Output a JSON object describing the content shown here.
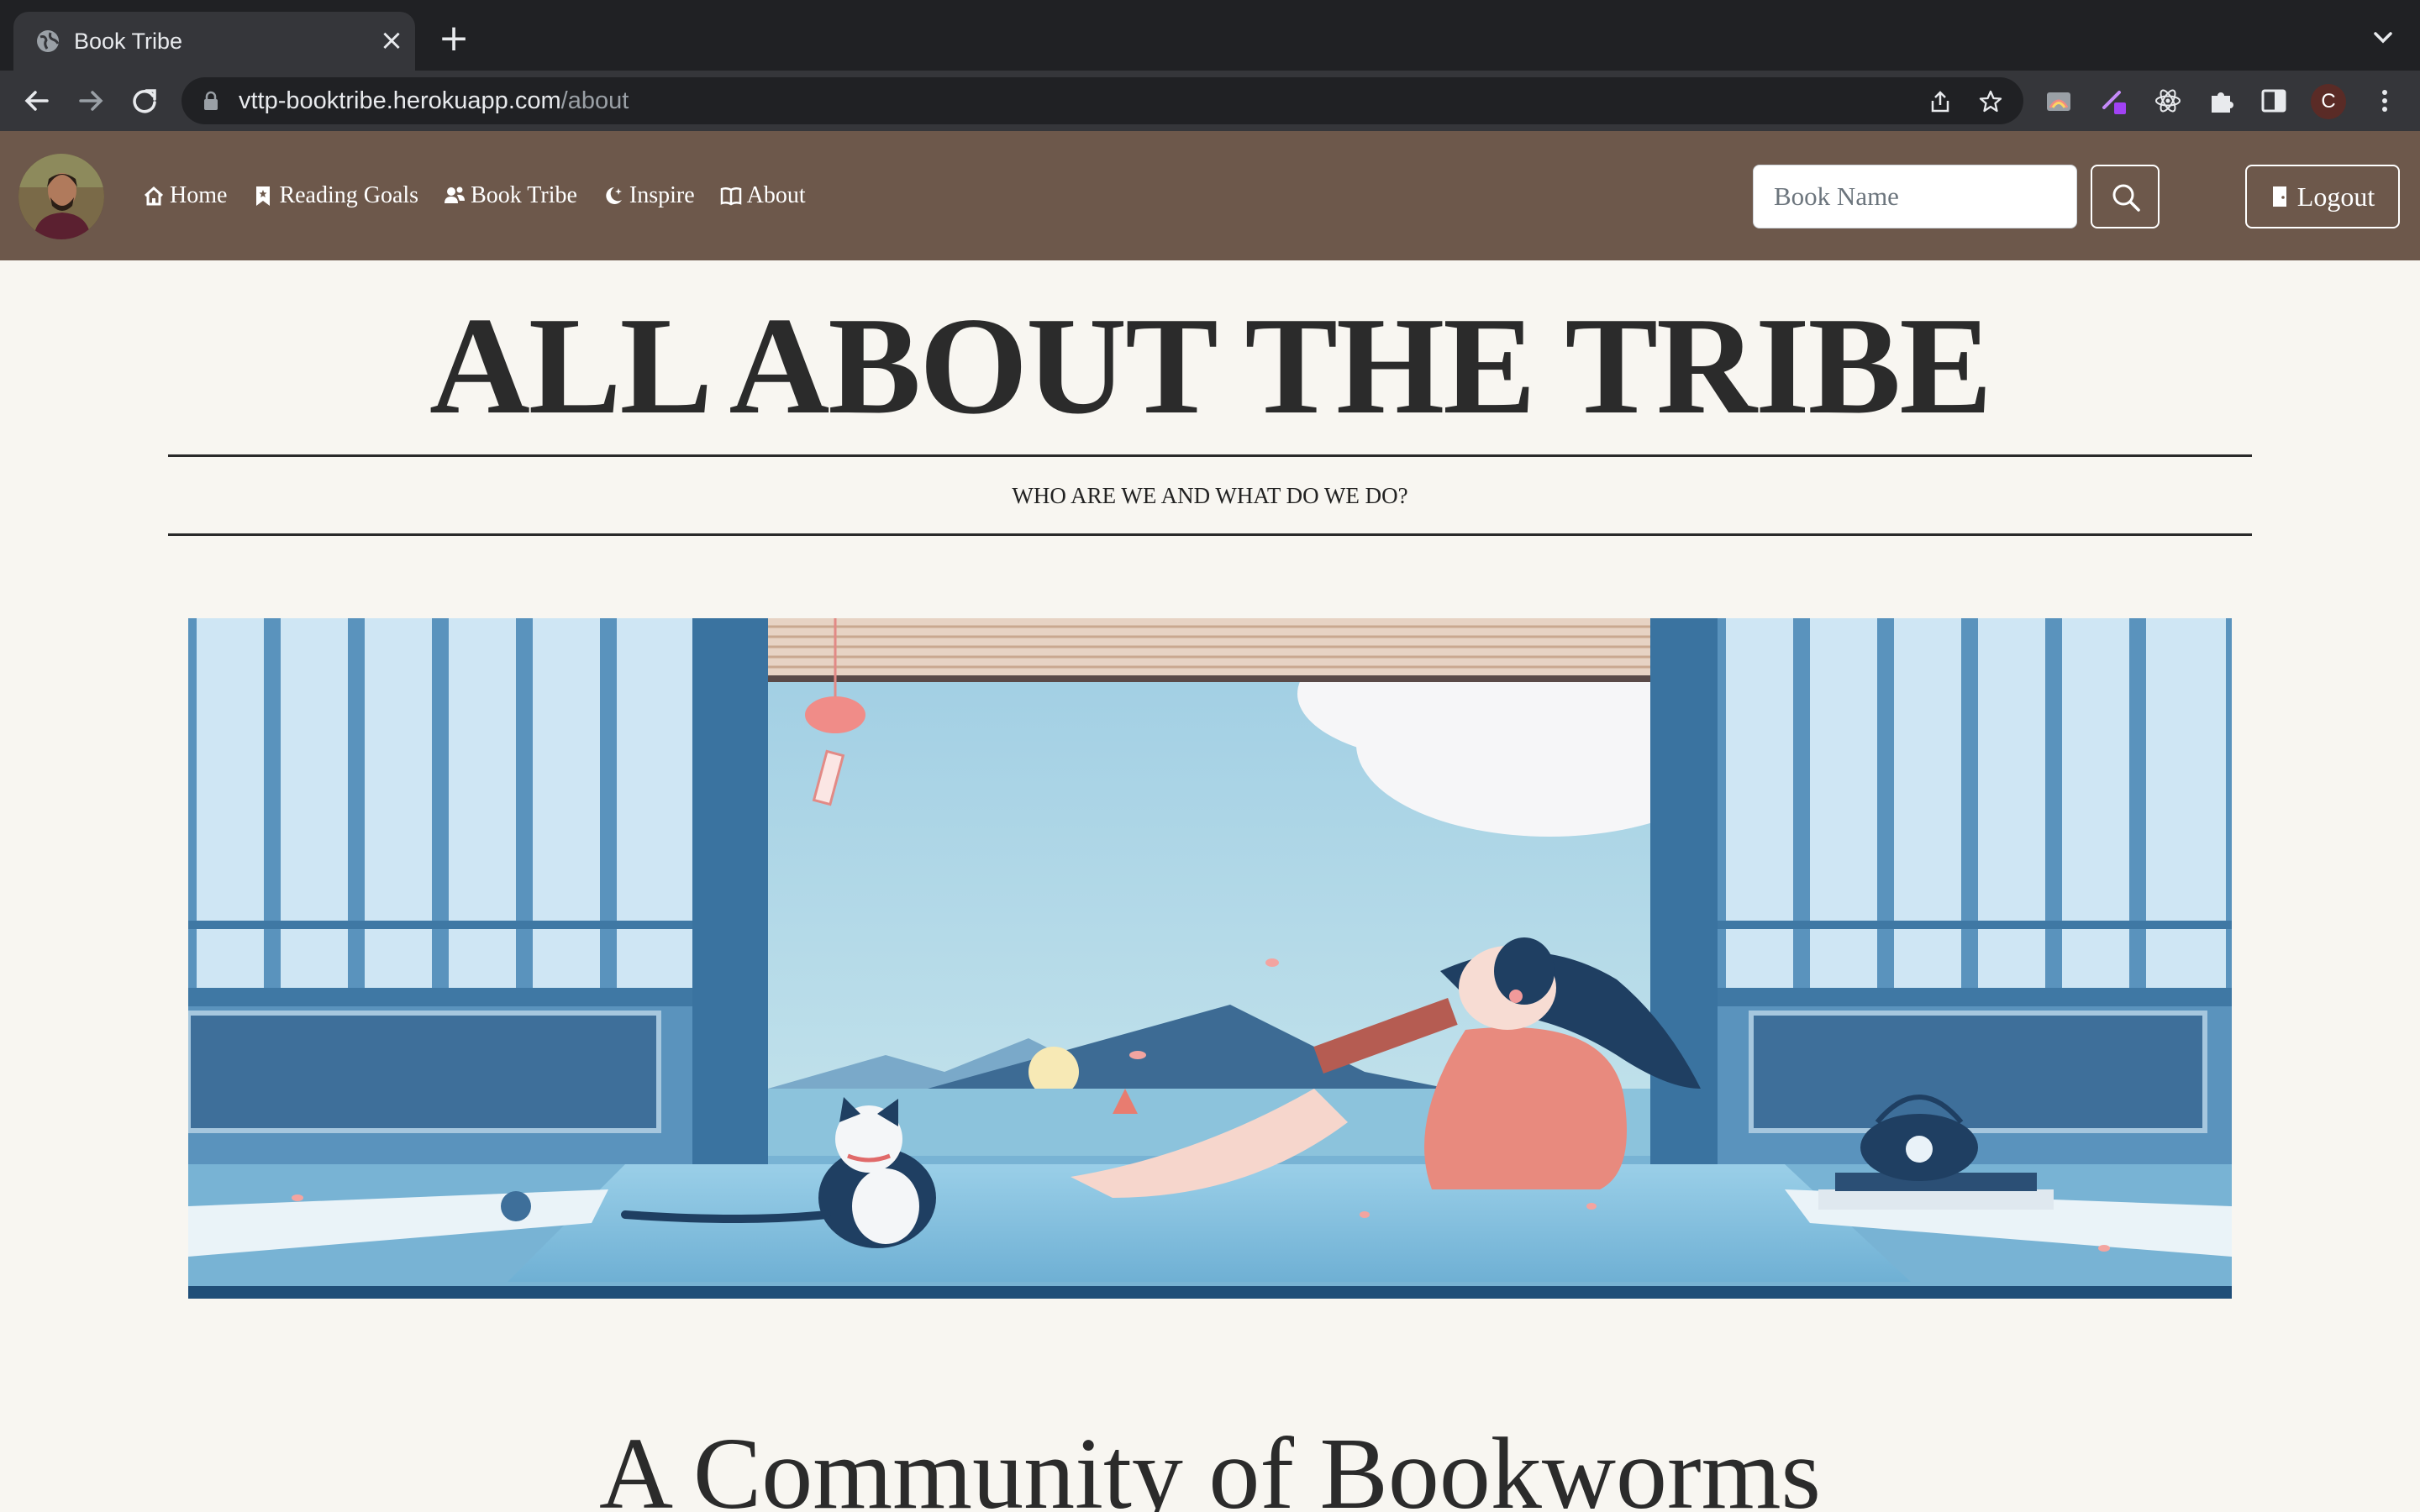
{
  "browser": {
    "tab_title": "Book Tribe",
    "url_host": "vttp-booktribe.herokuapp.com",
    "url_path": "/about",
    "profile_initial": "C"
  },
  "site": {
    "nav": [
      {
        "label": "Home",
        "icon": "house-icon"
      },
      {
        "label": "Reading Goals",
        "icon": "bookmark-icon"
      },
      {
        "label": "Book Tribe",
        "icon": "people-icon"
      },
      {
        "label": "Inspire",
        "icon": "moon-stars-icon"
      },
      {
        "label": "About",
        "icon": "book-icon"
      }
    ],
    "search_placeholder": "Book Name",
    "logout_label": "Logout"
  },
  "page": {
    "title": "ALL ABOUT THE TRIBE",
    "subtitle": "WHO ARE WE AND WHAT DO WE DO?",
    "section_heading": "A Community of Bookworms"
  },
  "colors": {
    "navbar": "#6d584b",
    "page_bg": "#f8f6f1",
    "text": "#2b2b2b"
  }
}
